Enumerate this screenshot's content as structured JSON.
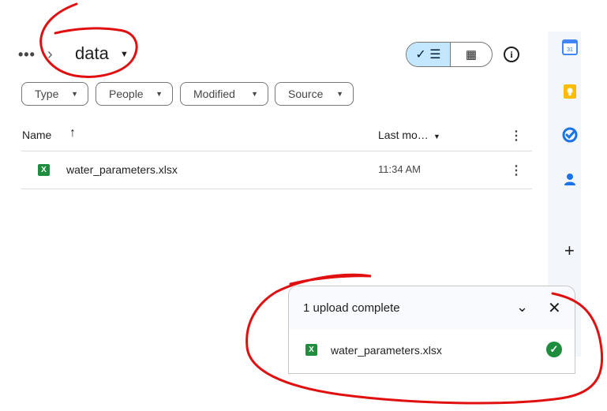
{
  "breadcrumb": {
    "more_icon": "more-horiz-icon",
    "chevron_icon": "chevron-right-icon",
    "folder": "data"
  },
  "view": {
    "list_icon": "check-list-icon",
    "grid_icon": "grid-icon",
    "info_icon": "info-icon",
    "active": "list",
    "active_color": "#c2e7ff"
  },
  "filters": [
    {
      "label": "Type"
    },
    {
      "label": "People"
    },
    {
      "label": "Modified"
    },
    {
      "label": "Source"
    }
  ],
  "table": {
    "columns": {
      "name": "Name",
      "last_modified": "Last mo…"
    },
    "rows": [
      {
        "name": "water_parameters.xlsx",
        "modified": "11:34 AM",
        "icon": "excel-icon",
        "icon_letter": "X"
      }
    ]
  },
  "side_panel": {
    "apps": [
      "calendar-icon",
      "keep-icon",
      "tasks-icon",
      "contacts-icon"
    ],
    "calendar_day": "31",
    "add_icon": "plus-icon"
  },
  "upload": {
    "title": "1 upload complete",
    "items": [
      {
        "name": "water_parameters.xlsx",
        "icon_letter": "X",
        "status": "complete"
      }
    ]
  },
  "colors": {
    "excel_green": "#1e8e3e",
    "annotation_red": "#e01010",
    "side_panel": "#f3f6fb"
  }
}
